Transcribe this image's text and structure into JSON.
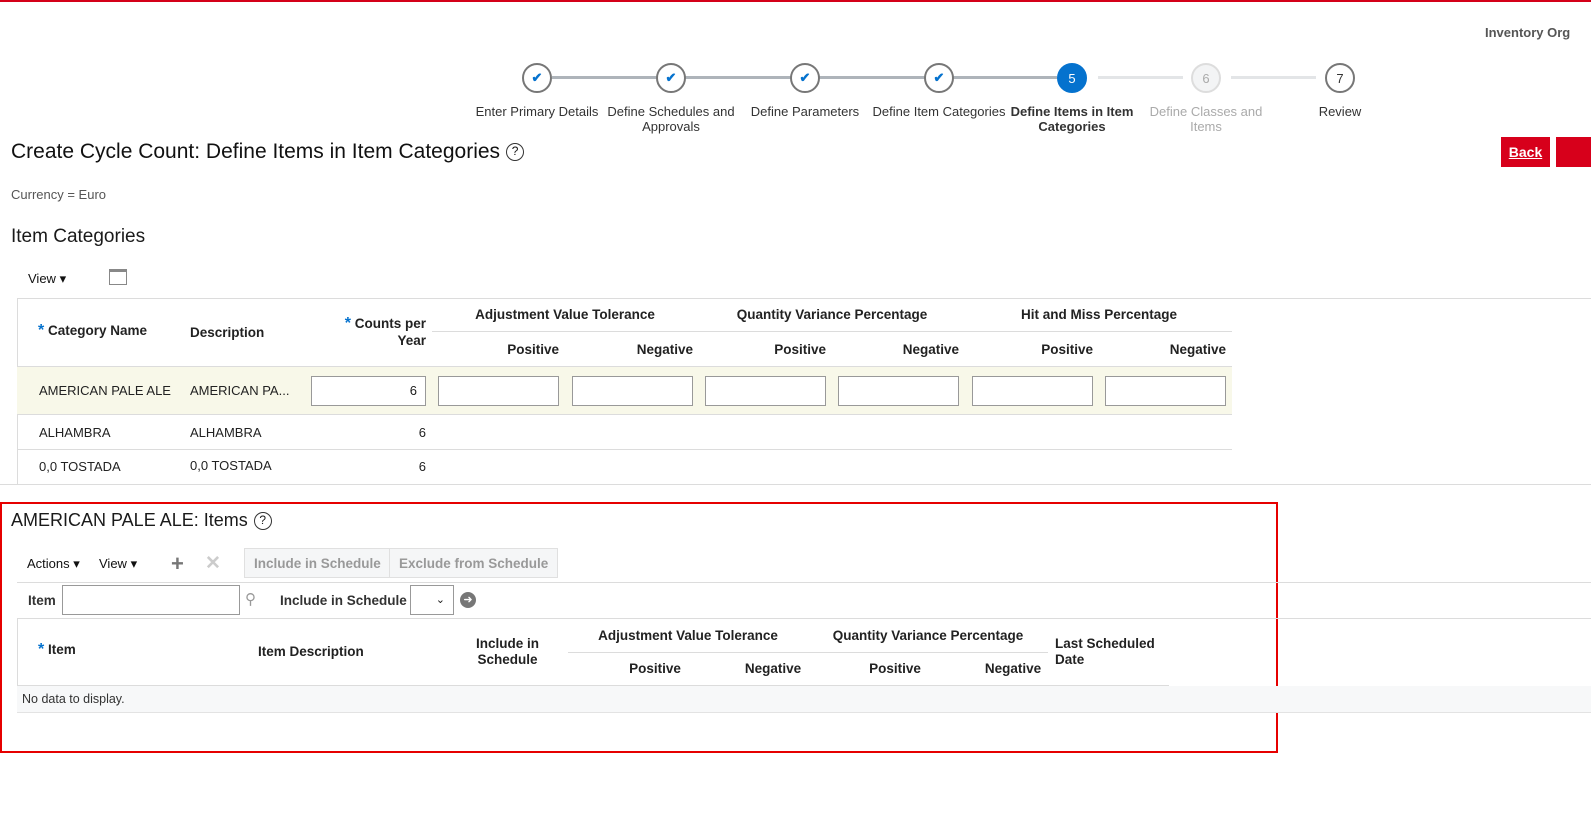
{
  "header": {
    "org_label": "Inventory Org"
  },
  "train": [
    {
      "num": "1",
      "label": "Enter Primary Details",
      "state": "done"
    },
    {
      "num": "2",
      "label": "Define Schedules and Approvals",
      "state": "done"
    },
    {
      "num": "3",
      "label": "Define Parameters",
      "state": "done"
    },
    {
      "num": "4",
      "label": "Define Item Categories",
      "state": "done"
    },
    {
      "num": "5",
      "label": "Define Items in Item Categories",
      "state": "current"
    },
    {
      "num": "6",
      "label": "Define Classes and Items",
      "state": "disabled"
    },
    {
      "num": "7",
      "label": "Review",
      "state": "pending"
    }
  ],
  "page": {
    "title": "Create Cycle Count: Define Items in Item Categories",
    "help": "?",
    "back": "Back",
    "currency": "Currency = Euro"
  },
  "categories": {
    "title": "Item Categories",
    "view": "View",
    "headers": {
      "category": "Category Name",
      "description": "Description",
      "counts": "Counts per Year",
      "adj": "Adjustment Value Tolerance",
      "qty": "Quantity Variance Percentage",
      "hit": "Hit and Miss Percentage",
      "positive": "Positive",
      "negative": "Negative"
    },
    "rows": [
      {
        "name": "AMERICAN PALE ALE",
        "description": "AMERICAN PA...",
        "counts": "6"
      },
      {
        "name": "ALHAMBRA",
        "description": "ALHAMBRA",
        "counts": "6"
      },
      {
        "name": "0,0 TOSTADA",
        "description": "0,0 TOSTADA",
        "counts": "6"
      }
    ]
  },
  "items": {
    "title": "AMERICAN PALE ALE: Items",
    "actions": "Actions",
    "view": "View",
    "include_btn": "Include in Schedule",
    "exclude_btn": "Exclude from Schedule",
    "filter": {
      "item_label": "Item",
      "item_value": "",
      "include_label": "Include in Schedule",
      "include_value": ""
    },
    "headers": {
      "item": "Item",
      "description": "Item Description",
      "include": "Include in Schedule",
      "adj": "Adjustment Value Tolerance",
      "qty": "Quantity Variance Percentage",
      "positive": "Positive",
      "negative": "Negative",
      "last": "Last Scheduled Date"
    },
    "empty": "No data to display."
  }
}
